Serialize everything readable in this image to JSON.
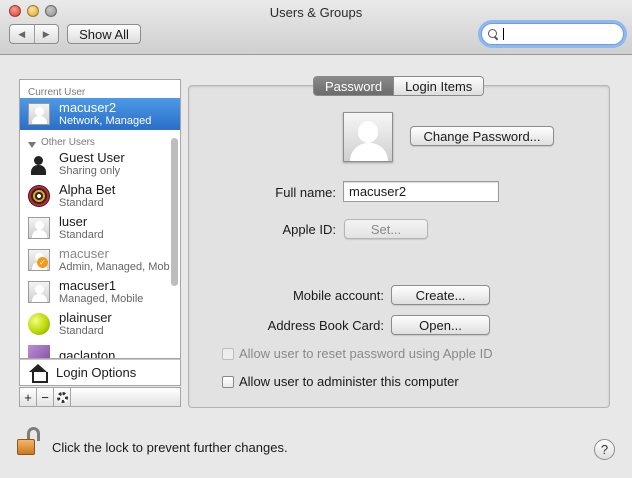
{
  "window": {
    "title": "Users & Groups"
  },
  "toolbar": {
    "back_glyph": "◀",
    "forward_glyph": "▶",
    "show_all_label": "Show All",
    "search_value": ""
  },
  "sidebar": {
    "current_user_header": "Current User",
    "other_users_header": "Other Users",
    "current_user": {
      "name": "macuser2",
      "subtitle": "Network, Managed",
      "icon": "generic-user-avatar"
    },
    "other_users": [
      {
        "name": "Guest User",
        "subtitle": "Sharing only",
        "icon": "guest-silhouette"
      },
      {
        "name": "Alpha Bet",
        "subtitle": "Standard",
        "icon": "target-avatar"
      },
      {
        "name": "luser",
        "subtitle": "Standard",
        "icon": "generic-user-avatar"
      },
      {
        "name": "macuser",
        "subtitle": "Admin, Managed, Mob",
        "icon": "generic-user-avatar-badge"
      },
      {
        "name": "macuser1",
        "subtitle": "Managed, Mobile",
        "icon": "generic-user-avatar"
      },
      {
        "name": "plainuser",
        "subtitle": "Standard",
        "icon": "tennis-ball-avatar"
      },
      {
        "name": "gaclapton",
        "subtitle": "",
        "icon": "flower-avatar"
      }
    ],
    "login_options_label": "Login Options",
    "add_glyph": "+",
    "remove_glyph": "−"
  },
  "tabs": [
    {
      "label": "Password",
      "active": true
    },
    {
      "label": "Login Items",
      "active": false
    }
  ],
  "account": {
    "change_password_label": "Change Password...",
    "full_name_label": "Full name:",
    "full_name_value": "macuser2",
    "apple_id_label": "Apple ID:",
    "apple_id_button": "Set...",
    "mobile_account_label": "Mobile account:",
    "mobile_account_button": "Create...",
    "address_book_label": "Address Book Card:",
    "address_book_button": "Open...",
    "reset_password_label": "Allow user to reset password using Apple ID",
    "administer_label": "Allow user to administer this computer"
  },
  "footer": {
    "lock_text": "Click the lock to prevent further changes.",
    "help_glyph": "?"
  }
}
